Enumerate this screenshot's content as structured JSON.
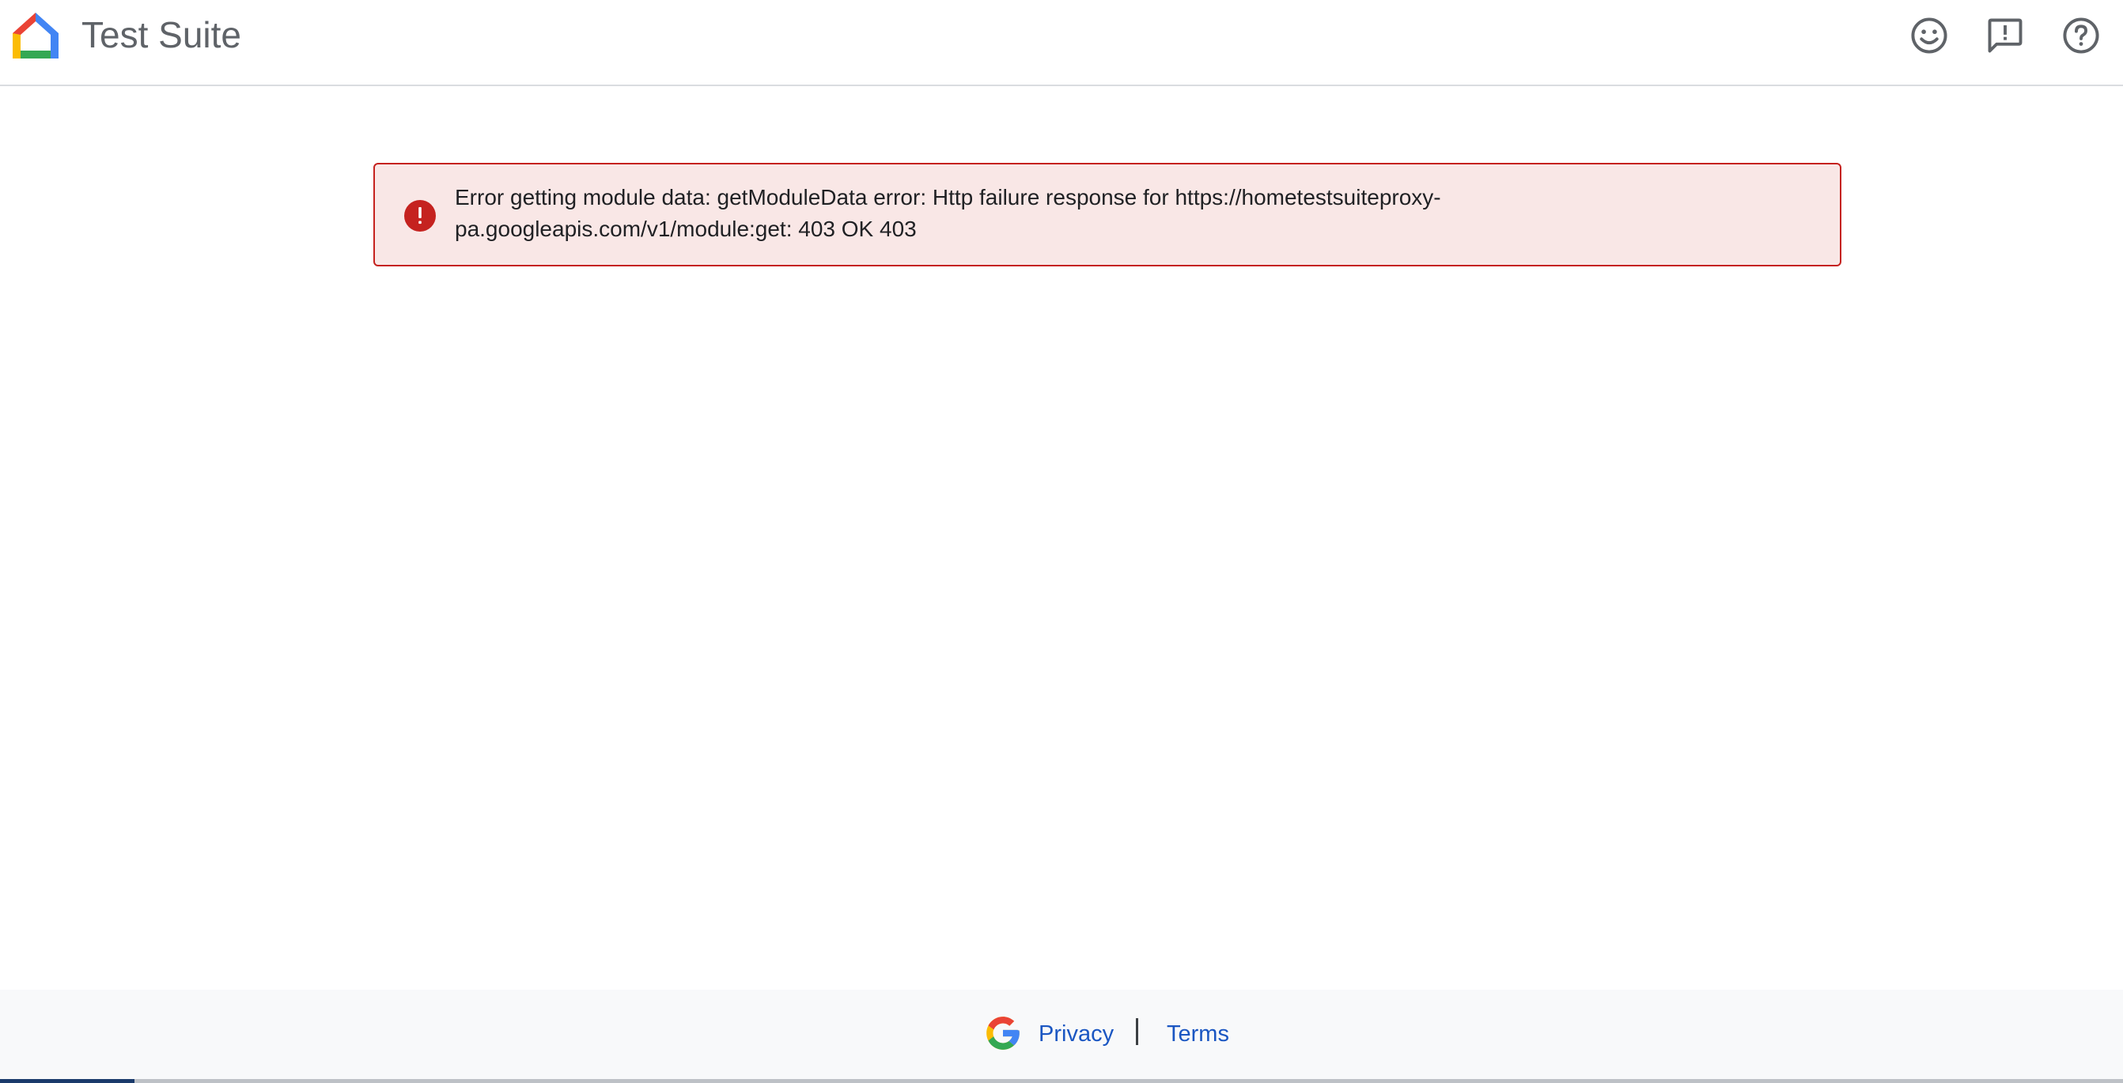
{
  "header": {
    "app_title": "Test Suite",
    "logo_icon": "google-home-logo-icon",
    "actions": [
      {
        "name": "feedback-smiley",
        "icon": "smiley-icon"
      },
      {
        "name": "report-issue",
        "icon": "feedback-exclamation-icon"
      },
      {
        "name": "help",
        "icon": "help-circle-icon"
      }
    ]
  },
  "error_banner": {
    "icon": "error-circle-icon",
    "message": "Error getting module data: getModuleData error: Http failure response for https://hometestsuiteproxy-\npa.googleapis.com/v1/module:get: 403 OK 403",
    "background_color": "#f9e7e6",
    "border_color": "#c5221f"
  },
  "footer": {
    "logo_icon": "google-g-icon",
    "privacy_label": "Privacy",
    "separator": "|",
    "terms_label": "Terms",
    "link_color": "#1a56c2"
  }
}
